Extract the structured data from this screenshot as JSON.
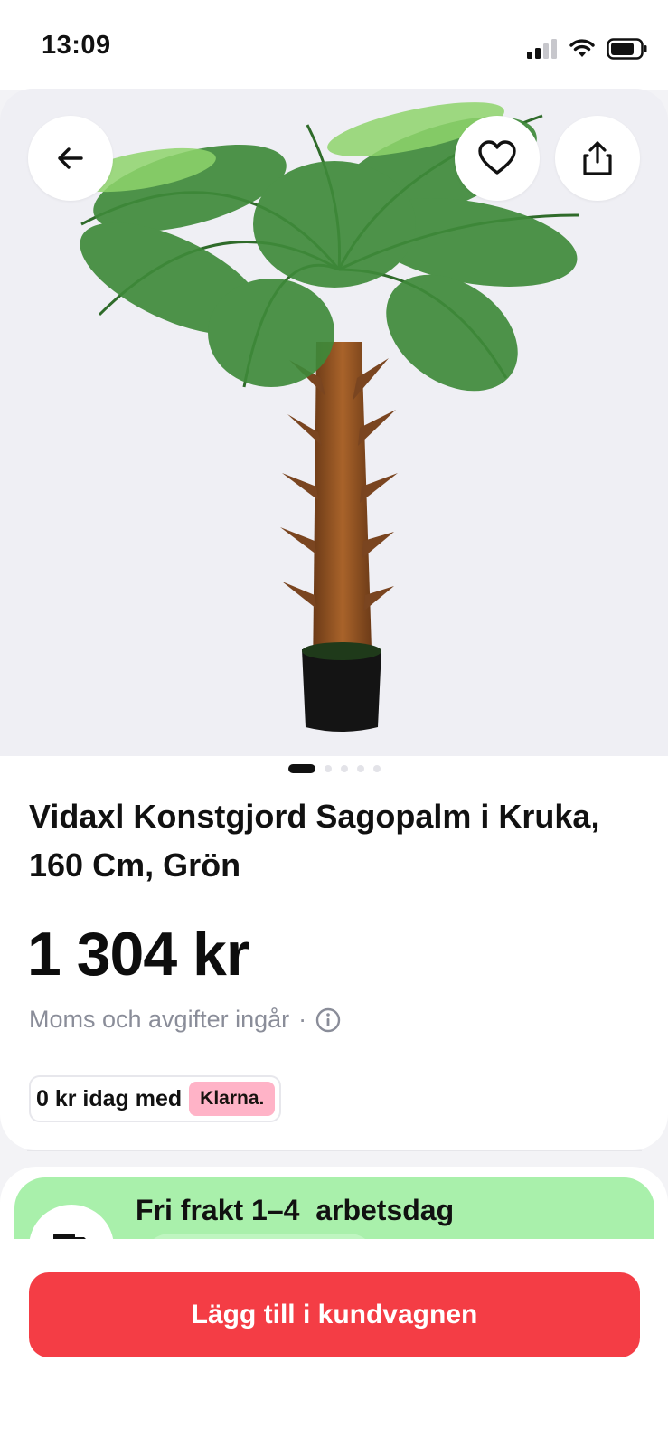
{
  "status_bar": {
    "time": "13:09"
  },
  "product": {
    "title": "Vidaxl Konstgjord Sagopalm i Kruka, 160 Cm, Grön",
    "price": "1 304 kr",
    "tax_note": "Moms och avgifter ingår",
    "tax_separator": "·",
    "image_count": 5,
    "active_image": 1
  },
  "klarna": {
    "text": "0 kr idag med",
    "logo": "Klarna."
  },
  "shipping": {
    "title": "Fri frakt 1–4  arbetsdag"
  },
  "actions": {
    "add_to_cart": "Lägg till i kundvagnen"
  },
  "icons": {
    "back": "arrow-left-icon",
    "favorite": "heart-icon",
    "share": "share-icon",
    "info": "info-icon",
    "truck": "truck-icon"
  },
  "colors": {
    "accent_button": "#f43d45",
    "shipping_bg": "#a9f0ab",
    "klarna_pink": "#ffb3c7"
  }
}
